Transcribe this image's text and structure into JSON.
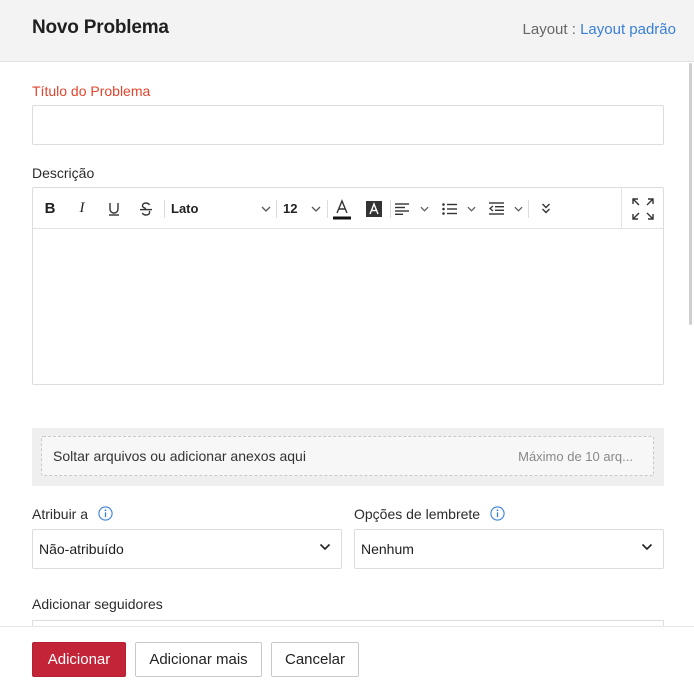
{
  "header": {
    "title": "Novo Problema",
    "layout_label": "Layout :",
    "layout_value": "Layout padrão"
  },
  "form": {
    "title_field": {
      "label": "Título do Problema",
      "value": ""
    },
    "description": {
      "label": "Descrição",
      "toolbar": {
        "bold": "B",
        "italic": "I",
        "font_name": "Lato",
        "font_size": "12",
        "icons": [
          "bold-icon",
          "italic-icon",
          "underline-icon",
          "strikethrough-icon",
          "font-color-icon",
          "background-color-icon",
          "align-icon",
          "list-icon",
          "indent-icon",
          "more-icon",
          "expand-icon"
        ]
      },
      "value": ""
    },
    "attachments": {
      "text": "Soltar arquivos ou adicionar anexos aqui",
      "max_text": "Máximo de 10 arq..."
    },
    "assign": {
      "label": "Atribuir a",
      "value": "Não-atribuído"
    },
    "reminder": {
      "label": "Opções de lembrete",
      "value": "Nenhum"
    },
    "followers": {
      "label": "Adicionar seguidores",
      "value": ""
    }
  },
  "footer": {
    "add": "Adicionar",
    "add_more": "Adicionar mais",
    "cancel": "Cancelar"
  },
  "colors": {
    "primary": "#c42437",
    "required_label": "#e0452c",
    "link": "#3a7fd5",
    "info_icon": "#3a7fd5"
  }
}
